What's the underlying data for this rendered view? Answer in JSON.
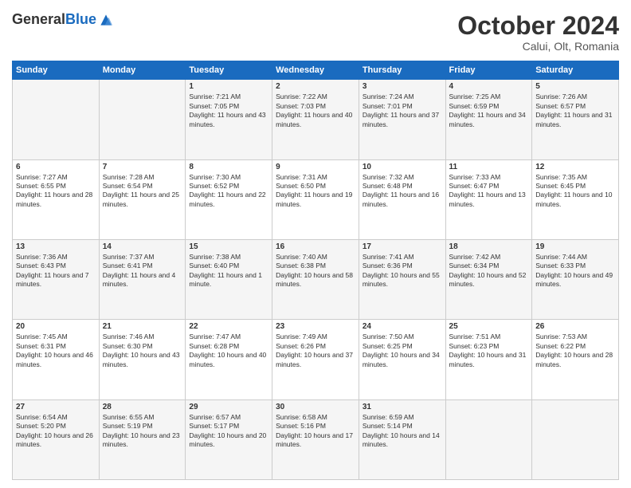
{
  "header": {
    "logo_general": "General",
    "logo_blue": "Blue",
    "month_title": "October 2024",
    "location": "Calui, Olt, Romania"
  },
  "weekdays": [
    "Sunday",
    "Monday",
    "Tuesday",
    "Wednesday",
    "Thursday",
    "Friday",
    "Saturday"
  ],
  "weeks": [
    [
      {
        "day": "",
        "sunrise": "",
        "sunset": "",
        "daylight": ""
      },
      {
        "day": "",
        "sunrise": "",
        "sunset": "",
        "daylight": ""
      },
      {
        "day": "1",
        "sunrise": "Sunrise: 7:21 AM",
        "sunset": "Sunset: 7:05 PM",
        "daylight": "Daylight: 11 hours and 43 minutes."
      },
      {
        "day": "2",
        "sunrise": "Sunrise: 7:22 AM",
        "sunset": "Sunset: 7:03 PM",
        "daylight": "Daylight: 11 hours and 40 minutes."
      },
      {
        "day": "3",
        "sunrise": "Sunrise: 7:24 AM",
        "sunset": "Sunset: 7:01 PM",
        "daylight": "Daylight: 11 hours and 37 minutes."
      },
      {
        "day": "4",
        "sunrise": "Sunrise: 7:25 AM",
        "sunset": "Sunset: 6:59 PM",
        "daylight": "Daylight: 11 hours and 34 minutes."
      },
      {
        "day": "5",
        "sunrise": "Sunrise: 7:26 AM",
        "sunset": "Sunset: 6:57 PM",
        "daylight": "Daylight: 11 hours and 31 minutes."
      }
    ],
    [
      {
        "day": "6",
        "sunrise": "Sunrise: 7:27 AM",
        "sunset": "Sunset: 6:55 PM",
        "daylight": "Daylight: 11 hours and 28 minutes."
      },
      {
        "day": "7",
        "sunrise": "Sunrise: 7:28 AM",
        "sunset": "Sunset: 6:54 PM",
        "daylight": "Daylight: 11 hours and 25 minutes."
      },
      {
        "day": "8",
        "sunrise": "Sunrise: 7:30 AM",
        "sunset": "Sunset: 6:52 PM",
        "daylight": "Daylight: 11 hours and 22 minutes."
      },
      {
        "day": "9",
        "sunrise": "Sunrise: 7:31 AM",
        "sunset": "Sunset: 6:50 PM",
        "daylight": "Daylight: 11 hours and 19 minutes."
      },
      {
        "day": "10",
        "sunrise": "Sunrise: 7:32 AM",
        "sunset": "Sunset: 6:48 PM",
        "daylight": "Daylight: 11 hours and 16 minutes."
      },
      {
        "day": "11",
        "sunrise": "Sunrise: 7:33 AM",
        "sunset": "Sunset: 6:47 PM",
        "daylight": "Daylight: 11 hours and 13 minutes."
      },
      {
        "day": "12",
        "sunrise": "Sunrise: 7:35 AM",
        "sunset": "Sunset: 6:45 PM",
        "daylight": "Daylight: 11 hours and 10 minutes."
      }
    ],
    [
      {
        "day": "13",
        "sunrise": "Sunrise: 7:36 AM",
        "sunset": "Sunset: 6:43 PM",
        "daylight": "Daylight: 11 hours and 7 minutes."
      },
      {
        "day": "14",
        "sunrise": "Sunrise: 7:37 AM",
        "sunset": "Sunset: 6:41 PM",
        "daylight": "Daylight: 11 hours and 4 minutes."
      },
      {
        "day": "15",
        "sunrise": "Sunrise: 7:38 AM",
        "sunset": "Sunset: 6:40 PM",
        "daylight": "Daylight: 11 hours and 1 minute."
      },
      {
        "day": "16",
        "sunrise": "Sunrise: 7:40 AM",
        "sunset": "Sunset: 6:38 PM",
        "daylight": "Daylight: 10 hours and 58 minutes."
      },
      {
        "day": "17",
        "sunrise": "Sunrise: 7:41 AM",
        "sunset": "Sunset: 6:36 PM",
        "daylight": "Daylight: 10 hours and 55 minutes."
      },
      {
        "day": "18",
        "sunrise": "Sunrise: 7:42 AM",
        "sunset": "Sunset: 6:34 PM",
        "daylight": "Daylight: 10 hours and 52 minutes."
      },
      {
        "day": "19",
        "sunrise": "Sunrise: 7:44 AM",
        "sunset": "Sunset: 6:33 PM",
        "daylight": "Daylight: 10 hours and 49 minutes."
      }
    ],
    [
      {
        "day": "20",
        "sunrise": "Sunrise: 7:45 AM",
        "sunset": "Sunset: 6:31 PM",
        "daylight": "Daylight: 10 hours and 46 minutes."
      },
      {
        "day": "21",
        "sunrise": "Sunrise: 7:46 AM",
        "sunset": "Sunset: 6:30 PM",
        "daylight": "Daylight: 10 hours and 43 minutes."
      },
      {
        "day": "22",
        "sunrise": "Sunrise: 7:47 AM",
        "sunset": "Sunset: 6:28 PM",
        "daylight": "Daylight: 10 hours and 40 minutes."
      },
      {
        "day": "23",
        "sunrise": "Sunrise: 7:49 AM",
        "sunset": "Sunset: 6:26 PM",
        "daylight": "Daylight: 10 hours and 37 minutes."
      },
      {
        "day": "24",
        "sunrise": "Sunrise: 7:50 AM",
        "sunset": "Sunset: 6:25 PM",
        "daylight": "Daylight: 10 hours and 34 minutes."
      },
      {
        "day": "25",
        "sunrise": "Sunrise: 7:51 AM",
        "sunset": "Sunset: 6:23 PM",
        "daylight": "Daylight: 10 hours and 31 minutes."
      },
      {
        "day": "26",
        "sunrise": "Sunrise: 7:53 AM",
        "sunset": "Sunset: 6:22 PM",
        "daylight": "Daylight: 10 hours and 28 minutes."
      }
    ],
    [
      {
        "day": "27",
        "sunrise": "Sunrise: 6:54 AM",
        "sunset": "Sunset: 5:20 PM",
        "daylight": "Daylight: 10 hours and 26 minutes."
      },
      {
        "day": "28",
        "sunrise": "Sunrise: 6:55 AM",
        "sunset": "Sunset: 5:19 PM",
        "daylight": "Daylight: 10 hours and 23 minutes."
      },
      {
        "day": "29",
        "sunrise": "Sunrise: 6:57 AM",
        "sunset": "Sunset: 5:17 PM",
        "daylight": "Daylight: 10 hours and 20 minutes."
      },
      {
        "day": "30",
        "sunrise": "Sunrise: 6:58 AM",
        "sunset": "Sunset: 5:16 PM",
        "daylight": "Daylight: 10 hours and 17 minutes."
      },
      {
        "day": "31",
        "sunrise": "Sunrise: 6:59 AM",
        "sunset": "Sunset: 5:14 PM",
        "daylight": "Daylight: 10 hours and 14 minutes."
      },
      {
        "day": "",
        "sunrise": "",
        "sunset": "",
        "daylight": ""
      },
      {
        "day": "",
        "sunrise": "",
        "sunset": "",
        "daylight": ""
      }
    ]
  ]
}
